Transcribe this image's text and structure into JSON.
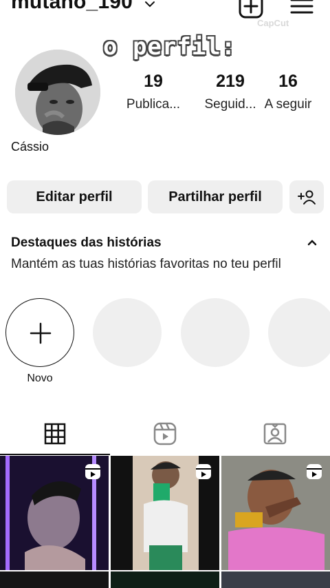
{
  "header": {
    "username": "mutano_190",
    "chevron_icon": "chevron-down-icon",
    "add_icon": "plus-square-icon",
    "menu_icon": "hamburger-menu-icon"
  },
  "overlay": {
    "watermark": "CapCut",
    "caption": "o perfil:"
  },
  "profile": {
    "display_name": "Cássio",
    "stats": [
      {
        "value": "19",
        "label": "Publica..."
      },
      {
        "value": "219",
        "label": "Seguid..."
      },
      {
        "value": "16",
        "label": "A seguir"
      }
    ]
  },
  "actions": {
    "edit_label": "Editar perfil",
    "share_label": "Partilhar perfil",
    "add_user_icon": "add-person-icon"
  },
  "highlights": {
    "title": "Destaques das histórias",
    "description": "Mantém as tuas histórias favoritas no teu perfil",
    "new_label": "Novo"
  },
  "tabs": [
    {
      "icon": "grid-icon",
      "active": true
    },
    {
      "icon": "reels-icon",
      "active": false
    },
    {
      "icon": "tagged-icon",
      "active": false
    }
  ],
  "colors": {
    "button_bg": "#efefef",
    "placeholder_bg": "#efefef",
    "text": "#111111"
  }
}
